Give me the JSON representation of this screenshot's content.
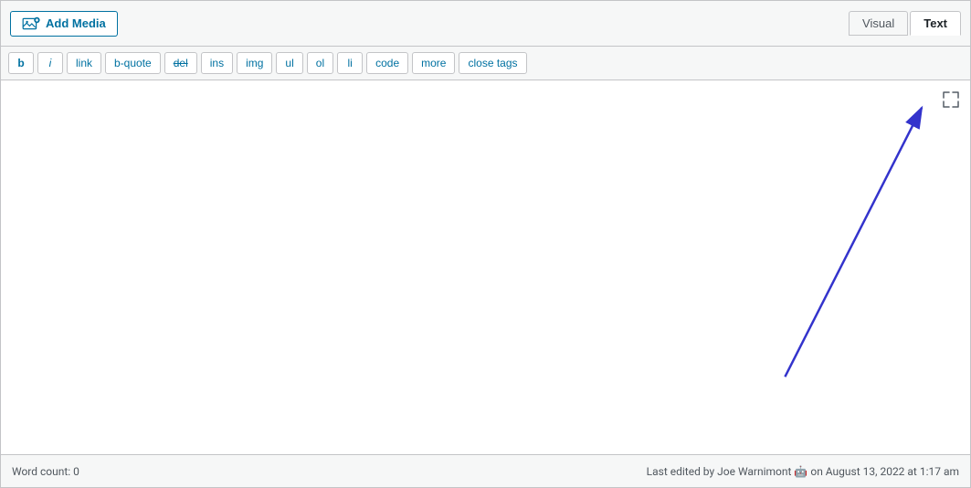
{
  "addMedia": {
    "label": "Add Media"
  },
  "tabs": {
    "visual": "Visual",
    "text": "Text",
    "active": "text"
  },
  "toolbar": {
    "buttons": [
      {
        "id": "bold",
        "label": "b",
        "class": "bold"
      },
      {
        "id": "italic",
        "label": "i",
        "class": "italic"
      },
      {
        "id": "link",
        "label": "link",
        "class": ""
      },
      {
        "id": "bquote",
        "label": "b-quote",
        "class": ""
      },
      {
        "id": "del",
        "label": "del",
        "class": "strike"
      },
      {
        "id": "ins",
        "label": "ins",
        "class": ""
      },
      {
        "id": "img",
        "label": "img",
        "class": ""
      },
      {
        "id": "ul",
        "label": "ul",
        "class": ""
      },
      {
        "id": "ol",
        "label": "ol",
        "class": ""
      },
      {
        "id": "li",
        "label": "li",
        "class": ""
      },
      {
        "id": "code",
        "label": "code",
        "class": ""
      },
      {
        "id": "more",
        "label": "more",
        "class": ""
      },
      {
        "id": "close-tags",
        "label": "close tags",
        "class": ""
      }
    ]
  },
  "editor": {
    "placeholder": "",
    "content": ""
  },
  "statusBar": {
    "wordCount": "Word count: 0",
    "lastEdited": "Last edited by Joe Warnimont 🤖 on August 13, 2022 at 1:17 am"
  },
  "fullscreen": {
    "icon": "⤢"
  }
}
